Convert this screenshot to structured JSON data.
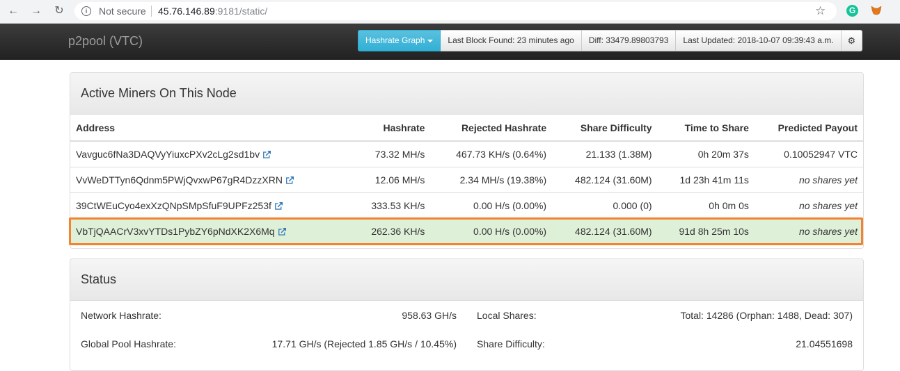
{
  "browser": {
    "security_label": "Not secure",
    "url_host": "45.76.146.89",
    "url_rest": ":9181/static/"
  },
  "navbar": {
    "brand": "p2pool (VTC)",
    "hashrate_graph": "Hashrate Graph",
    "last_block": "Last Block Found: 23 minutes ago",
    "diff": "Diff: 33479.89803793",
    "last_updated": "Last Updated: 2018-10-07 09:39:43 a.m."
  },
  "miners_panel": {
    "title": "Active Miners On This Node",
    "columns": [
      "Address",
      "Hashrate",
      "Rejected Hashrate",
      "Share Difficulty",
      "Time to Share",
      "Predicted Payout"
    ],
    "rows": [
      {
        "address": "Vavguc6fNa3DAQVyYiuxcPXv2cLg2sd1bv",
        "hashrate": "73.32 MH/s",
        "rejected": "467.73 KH/s (0.64%)",
        "difficulty": "21.133 (1.38M)",
        "time": "0h 20m 37s",
        "payout": "0.10052947 VTC"
      },
      {
        "address": "VvWeDTTyn6Qdnm5PWjQvxwP67gR4DzzXRN",
        "hashrate": "12.06 MH/s",
        "rejected": "2.34 MH/s (19.38%)",
        "difficulty": "482.124 (31.60M)",
        "time": "1d 23h 41m 11s",
        "payout": "no shares yet"
      },
      {
        "address": "39CtWEuCyo4exXzQNpSMpSfuF9UPFz253f",
        "hashrate": "333.53 KH/s",
        "rejected": "0.00 H/s (0.00%)",
        "difficulty": "0.000 (0)",
        "time": "0h 0m 0s",
        "payout": "no shares yet"
      },
      {
        "address": "VbTjQAACrV3xvYTDs1PybZY6pNdXK2X6Mq",
        "hashrate": "262.36 KH/s",
        "rejected": "0.00 H/s (0.00%)",
        "difficulty": "482.124 (31.60M)",
        "time": "91d 8h 25m 10s",
        "payout": "no shares yet"
      }
    ]
  },
  "status_panel": {
    "title": "Status",
    "network_hashrate_label": "Network Hashrate:",
    "network_hashrate_value": "958.63 GH/s",
    "local_shares_label": "Local Shares:",
    "local_shares_value": "Total: 14286 (Orphan: 1488, Dead: 307)",
    "global_pool_label": "Global Pool Hashrate:",
    "global_pool_value": "17.71 GH/s (Rejected 1.85 GH/s / 10.45%)",
    "share_difficulty_label": "Share Difficulty:",
    "share_difficulty_value": "21.04551698"
  },
  "colors": {
    "highlight_border": "#f5822e",
    "success_row": "#dff0d8",
    "info_button": "#31b0d5"
  }
}
